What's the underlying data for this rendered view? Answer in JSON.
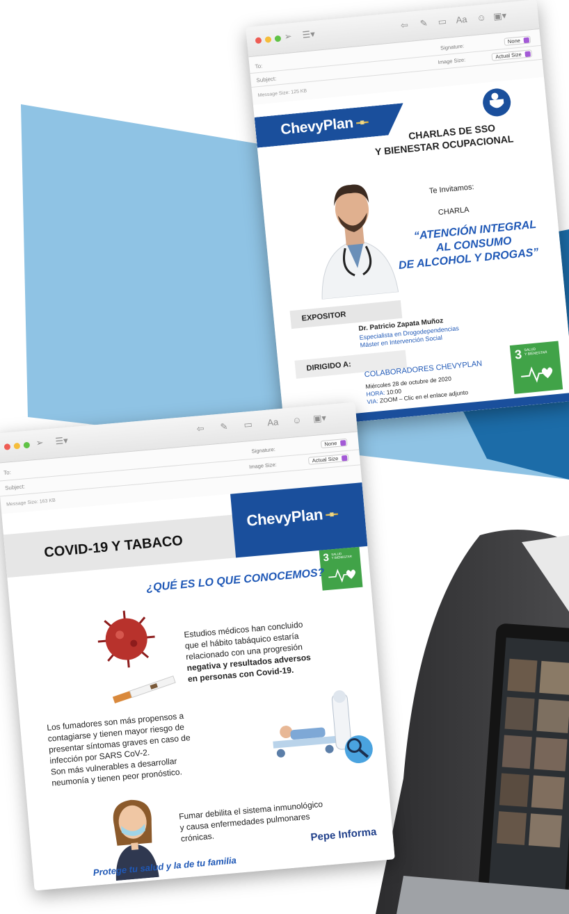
{
  "colors": {
    "sky": "#8fc3e4",
    "deep_blue": "#1a4f9c",
    "brand_blue": "#1f58b6",
    "green": "#41a348"
  },
  "window1": {
    "to_label": "To:",
    "subject_label": "Subject:",
    "signature_label": "Signature:",
    "signature_value": "None",
    "image_size_label": "Image Size:",
    "image_size_value": "Actual Size",
    "message_size": "Message Size: 125 KB",
    "toolbar_icons": [
      "send-icon",
      "format-list-icon",
      "reply-icon",
      "attachment-icon",
      "photo-browser-icon",
      "font-icon",
      "emoji-icon",
      "media-icon"
    ],
    "flyer": {
      "brand": "ChevyPlan",
      "heading_line1": "CHARLAS DE SSO",
      "heading_line2": "Y BIENESTAR OCUPACIONAL",
      "invite": "Te Invitamos:",
      "charla": "CHARLA",
      "title_line1": "“ATENCIÓN INTEGRAL",
      "title_line2": "AL CONSUMO",
      "title_line3": "DE ALCOHOL Y DROGAS”",
      "expositor_label": "EXPOSITOR",
      "speaker_name": "Dr. Patricio Zapata Muñoz",
      "speaker_role1": "Especialista en Drogodependencias",
      "speaker_role2": "Máster en Intervención Social",
      "dirigido_label": "DIRIGIDO A:",
      "audience": "COLABORADORES CHEVYPLAN",
      "date": "Miércoles 28 de octubre de 2020",
      "hora_label": "HORA:",
      "hora": "10:00",
      "via_label": "VIA:",
      "via": "ZOOM – Clic en el enlace adjunto",
      "sdg_number": "3",
      "sdg_text": "SALUD\nY BIENESTAR"
    }
  },
  "window2": {
    "to_label": "To:",
    "subject_label": "Subject:",
    "signature_label": "Signature:",
    "signature_value": "None",
    "image_size_label": "Image Size:",
    "image_size_value": "Actual Size",
    "message_size": "Message Size: 163 KB",
    "flyer": {
      "brand": "ChevyPlan",
      "title": "COVID-19 Y TABACO",
      "question": "¿QUÉ ES LO QUE CONOCEMOS?",
      "p1_l1": "Estudios médicos han concluido",
      "p1_l2": "que el hábito tabáquico estaría",
      "p1_l3": "relacionado con una progresión",
      "p1_l4": "negativa y resultados adversos",
      "p1_l5": "en personas con Covid-19.",
      "p2_l1": "Los fumadores son más propensos a",
      "p2_l2": "contagiarse y tienen mayor riesgo de",
      "p2_l3": "presentar síntomas graves en caso de",
      "p2_l4": "infección por SARS CoV-2.",
      "p2_l5": "Son más vulnerables a desarrollar",
      "p2_l6": "neumonía y tienen peor pronóstico.",
      "p3_l1": "Fumar debilita el sistema inmunológico",
      "p3_l2": "y causa enfermedades pulmonares",
      "p3_l3": "crónicas.",
      "footer": "Protege tu salud y la de tu familia",
      "watermark": "Pepe Informa",
      "sdg_number": "3",
      "sdg_text": "SALUD\nY BIENESTAR"
    }
  }
}
